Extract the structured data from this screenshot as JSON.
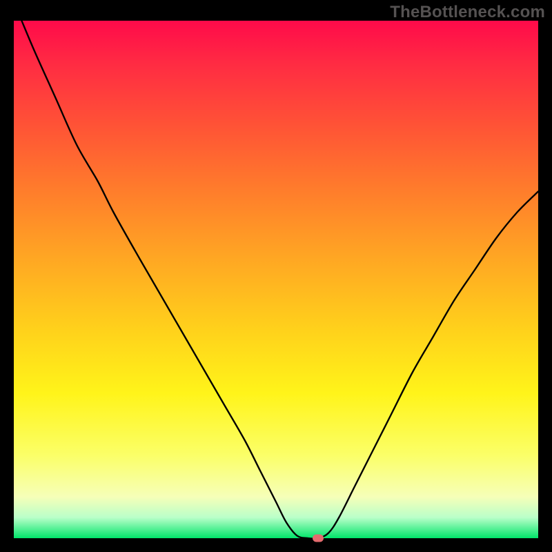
{
  "watermark": "TheBottleneck.com",
  "colors": {
    "background": "#000000",
    "curve": "#000000",
    "marker": "#e46b6e",
    "gradient_top": "#ff0a4a",
    "gradient_bottom": "#00e56a"
  },
  "chart_data": {
    "type": "line",
    "title": "",
    "xlabel": "",
    "ylabel": "",
    "xlim": [
      0,
      100
    ],
    "ylim": [
      0,
      100
    ],
    "grid": false,
    "legend": false,
    "annotations": [],
    "curve_points": [
      {
        "x": 1.5,
        "y": 100
      },
      {
        "x": 4,
        "y": 94
      },
      {
        "x": 8,
        "y": 85
      },
      {
        "x": 12,
        "y": 76
      },
      {
        "x": 16,
        "y": 69
      },
      {
        "x": 19,
        "y": 63
      },
      {
        "x": 24,
        "y": 54
      },
      {
        "x": 28,
        "y": 47
      },
      {
        "x": 32,
        "y": 40
      },
      {
        "x": 36,
        "y": 33
      },
      {
        "x": 40,
        "y": 26
      },
      {
        "x": 44,
        "y": 19
      },
      {
        "x": 47,
        "y": 13
      },
      {
        "x": 50,
        "y": 7
      },
      {
        "x": 52,
        "y": 3
      },
      {
        "x": 54,
        "y": 0.5
      },
      {
        "x": 56,
        "y": 0
      },
      {
        "x": 58,
        "y": 0
      },
      {
        "x": 60,
        "y": 1
      },
      {
        "x": 62,
        "y": 4
      },
      {
        "x": 65,
        "y": 10
      },
      {
        "x": 68,
        "y": 16
      },
      {
        "x": 72,
        "y": 24
      },
      {
        "x": 76,
        "y": 32
      },
      {
        "x": 80,
        "y": 39
      },
      {
        "x": 84,
        "y": 46
      },
      {
        "x": 88,
        "y": 52
      },
      {
        "x": 92,
        "y": 58
      },
      {
        "x": 96,
        "y": 63
      },
      {
        "x": 100,
        "y": 67
      }
    ],
    "min_marker": {
      "x": 58,
      "y": 0
    }
  }
}
